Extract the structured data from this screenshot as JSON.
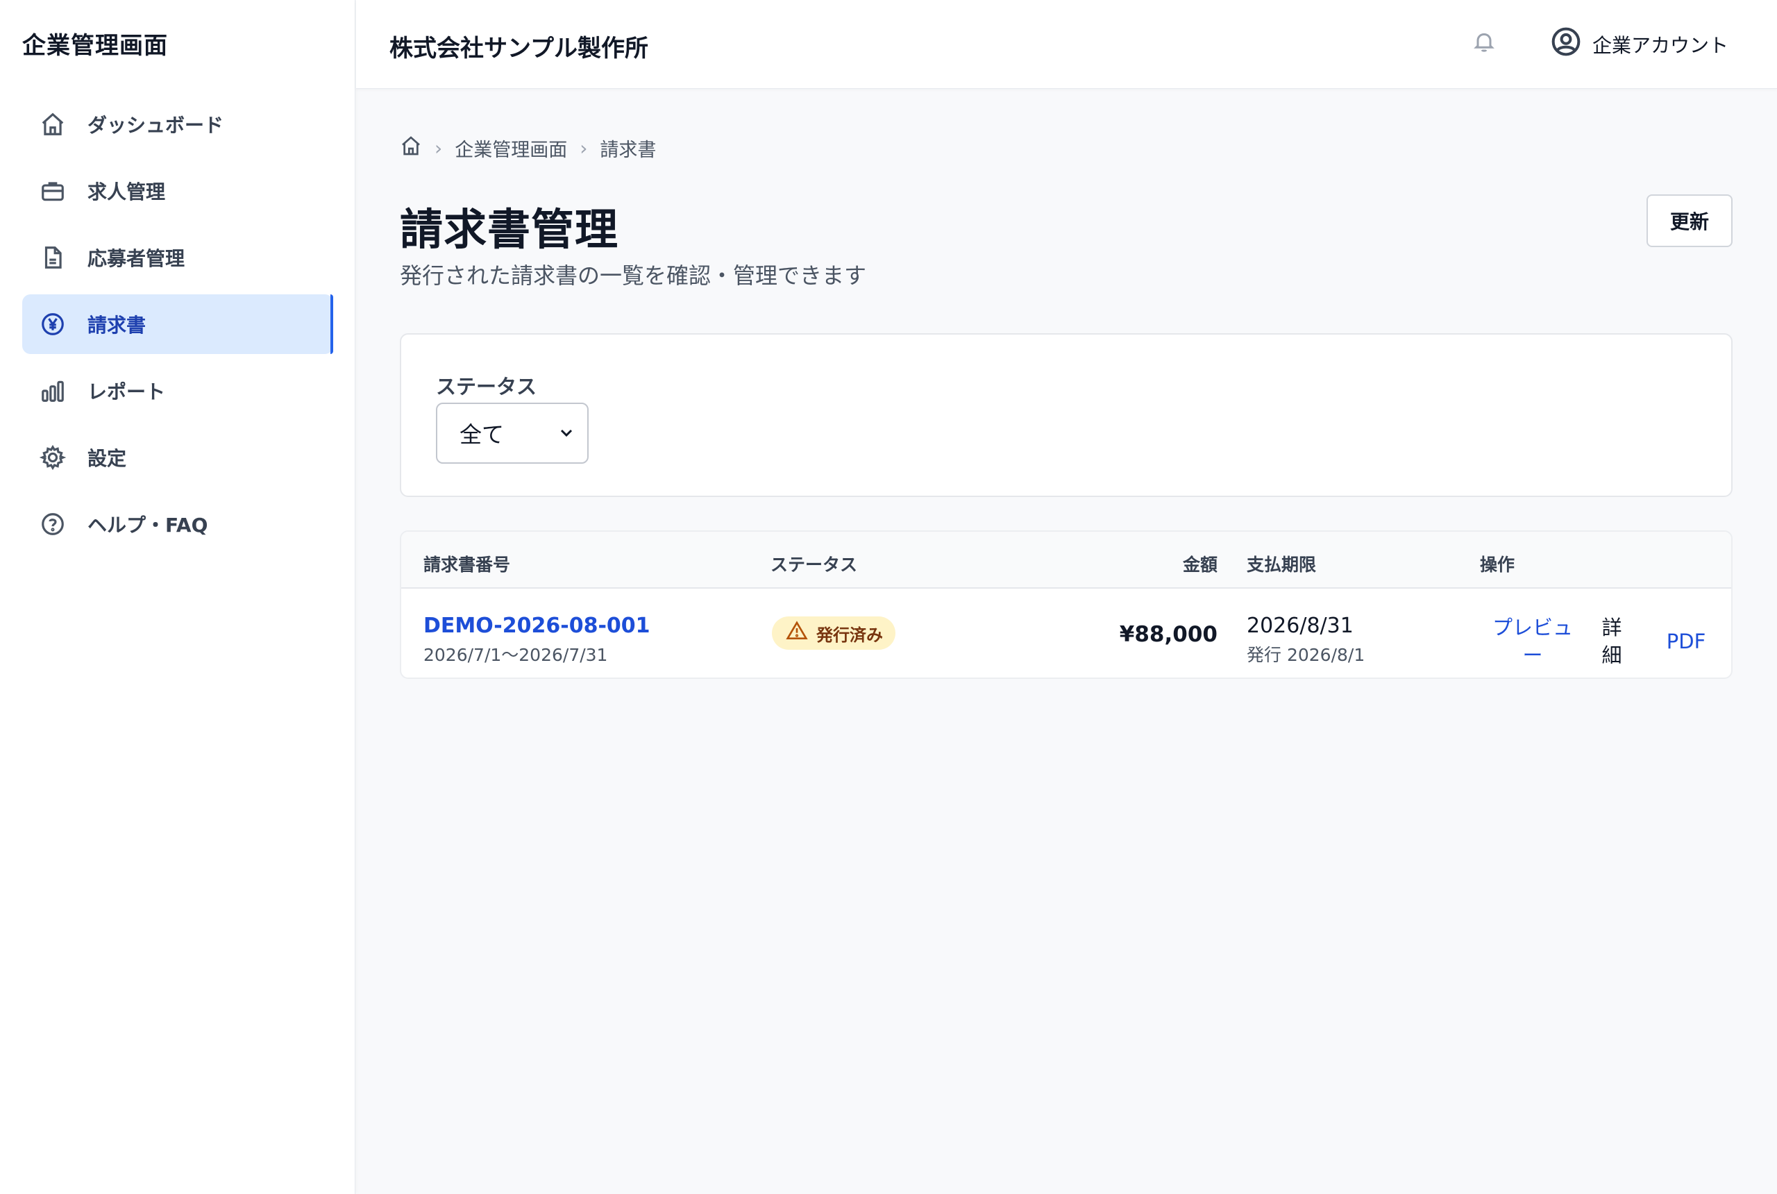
{
  "sidebar": {
    "title": "企業管理画面",
    "items": [
      {
        "label": "ダッシュボード",
        "icon": "home-icon"
      },
      {
        "label": "求人管理",
        "icon": "briefcase-icon"
      },
      {
        "label": "応募者管理",
        "icon": "document-icon"
      },
      {
        "label": "請求書",
        "icon": "yen-icon",
        "active": true
      },
      {
        "label": "レポート",
        "icon": "bar-chart-icon"
      },
      {
        "label": "設定",
        "icon": "gear-icon"
      },
      {
        "label": "ヘルプ・FAQ",
        "icon": "help-icon"
      }
    ]
  },
  "header": {
    "company": "株式会社サンプル製作所",
    "account_label": "企業アカウント"
  },
  "breadcrumb": {
    "items": [
      "企業管理画面",
      "請求書"
    ]
  },
  "page": {
    "title": "請求書管理",
    "subtitle": "発行された請求書の一覧を確認・管理できます",
    "refresh_label": "更新"
  },
  "filter": {
    "status_label": "ステータス",
    "status_value": "全て"
  },
  "table": {
    "headers": [
      "請求書番号",
      "ステータス",
      "金額",
      "支払期限",
      "操作"
    ],
    "rows": [
      {
        "invoice_no": "DEMO-2026-08-001",
        "period": "2026/7/1〜2026/7/31",
        "status": "発行済み",
        "amount": "¥88,000",
        "due": "2026/8/31",
        "issued": "発行 2026/8/1",
        "actions": {
          "preview": "プレビュー",
          "detail": "詳細",
          "pdf": "PDF"
        }
      }
    ]
  },
  "colors": {
    "accent": "#1d4ed8",
    "active_bg": "#dbeafe",
    "badge_bg": "#fef3c7"
  }
}
